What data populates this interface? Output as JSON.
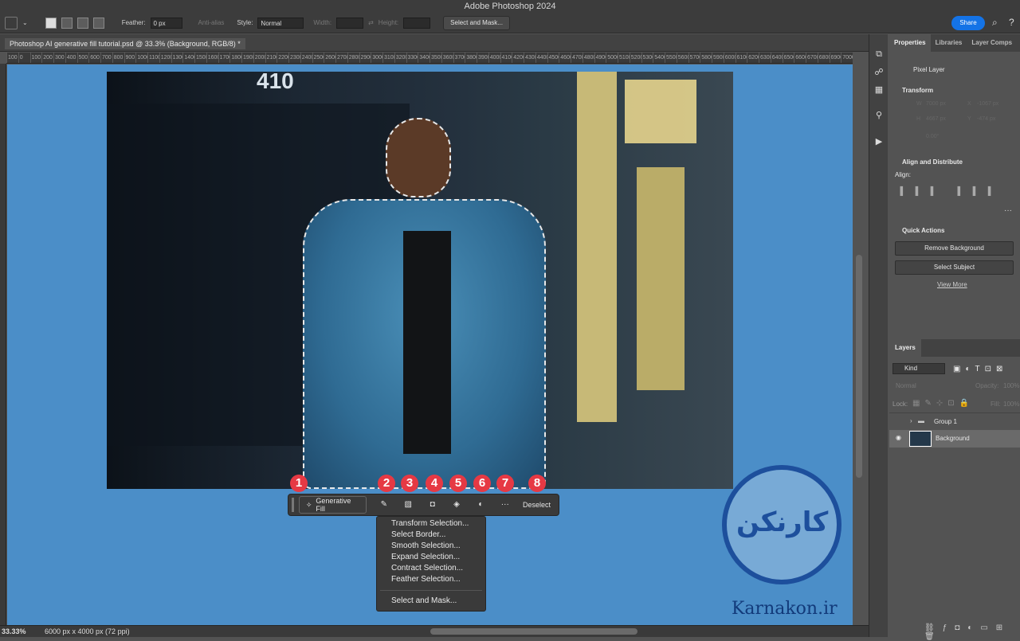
{
  "app": {
    "title": "Adobe Photoshop 2024"
  },
  "options_bar": {
    "feather_label": "Feather:",
    "feather_value": "0 px",
    "antialias_label": "Anti-alias",
    "style_label": "Style:",
    "style_value": "Normal",
    "width_label": "Width:",
    "height_label": "Height:",
    "select_mask_label": "Select and Mask...",
    "share_label": "Share"
  },
  "document": {
    "tab_title": "Photoshop AI generative fill tutorial.psd @ 33.3% (Background, RGB/8) *",
    "ruler_ticks": [
      "100",
      "0",
      "100",
      "200",
      "300",
      "400",
      "500",
      "600",
      "700",
      "800",
      "900",
      "1000",
      "1100",
      "1200",
      "1300",
      "1400",
      "1500",
      "1600",
      "1700",
      "1800",
      "1900",
      "2000",
      "2100",
      "2200",
      "2300",
      "2400",
      "2500",
      "2600",
      "2700",
      "2800",
      "2900",
      "3000",
      "3100",
      "3200",
      "3300",
      "3400",
      "3500",
      "3600",
      "3700",
      "3800",
      "3900",
      "4000",
      "4100",
      "4200",
      "4300",
      "4400",
      "4500",
      "4600",
      "4700",
      "4800",
      "4900",
      "5000",
      "5100",
      "5200",
      "5300",
      "5400",
      "5500",
      "5600",
      "5700",
      "5800",
      "5900",
      "6000",
      "6100",
      "6200",
      "6300",
      "6400",
      "6500",
      "6600",
      "6700",
      "6800",
      "6900",
      "7000"
    ],
    "photo_building_number": "410"
  },
  "context_bar": {
    "generative_fill_label": "Generative Fill",
    "deselect_label": "Deselect",
    "badges": [
      "1",
      "2",
      "3",
      "4",
      "5",
      "6",
      "7",
      "8"
    ]
  },
  "context_menu": {
    "items": [
      "Transform Selection...",
      "Select Border...",
      "Smooth Selection...",
      "Expand Selection...",
      "Contract Selection...",
      "Feather Selection..."
    ],
    "last_item": "Select and Mask..."
  },
  "watermark": {
    "logo_text": "کارنکن",
    "site": "Karnakon.ir"
  },
  "status_bar": {
    "zoom": "33.33%",
    "doc_info": "6000 px x 4000 px (72 ppi)"
  },
  "properties_panel": {
    "tabs": [
      "Properties",
      "Libraries",
      "Layer Comps"
    ],
    "pixel_layer": "Pixel Layer",
    "transform": "Transform",
    "w_label": "W",
    "w_value": "7000 px",
    "x_label": "X",
    "x_value": "-1067 px",
    "h_label": "H",
    "h_value": "4667 px",
    "y_label": "Y",
    "y_value": "-474 px",
    "angle_value": "0.00°",
    "align_distribute": "Align and Distribute",
    "align_label": "Align:",
    "quick_actions": "Quick Actions",
    "remove_bg": "Remove Background",
    "select_subject": "Select Subject",
    "view_more": "View More"
  },
  "layers_panel": {
    "tab": "Layers",
    "kind_label": "Kind",
    "blend_mode": "Normal",
    "opacity_label": "Opacity:",
    "opacity_value": "100%",
    "lock_label": "Lock:",
    "fill_label": "Fill:",
    "fill_value": "100%",
    "group_name": "Group 1",
    "background_name": "Background"
  }
}
